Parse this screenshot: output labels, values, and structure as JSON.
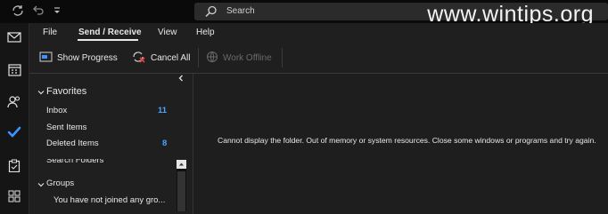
{
  "search": {
    "placeholder": "Search"
  },
  "watermark": "www.wintips.org",
  "ribbon": {
    "tabs": [
      {
        "label": "File"
      },
      {
        "label": "Send / Receive"
      },
      {
        "label": "View"
      },
      {
        "label": "Help"
      }
    ],
    "buttons": {
      "show_progress": "Show Progress",
      "cancel_all": "Cancel All",
      "work_offline": "Work Offline"
    }
  },
  "folders": {
    "favorites_label": "Favorites",
    "inbox": {
      "label": "Inbox",
      "count": "11"
    },
    "sent": {
      "label": "Sent Items"
    },
    "deleted": {
      "label": "Deleted Items",
      "count": "8"
    },
    "search_folders": "Search Folders",
    "groups_label": "Groups",
    "groups_msg": "You have not joined any gro..."
  },
  "content": {
    "message": "Cannot display the folder.  Out of memory or system resources. Close some windows or programs and try again."
  },
  "colors": {
    "accent": "#4aa3ff",
    "background": "#1f1f1f",
    "titlebar": "#0a0a0a"
  }
}
